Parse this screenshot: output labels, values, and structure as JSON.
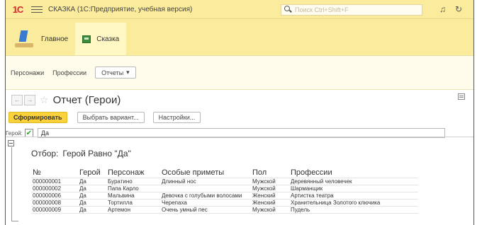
{
  "titlebar": {
    "logo": "1С",
    "title": "СКАЗКА  (1С:Предприятие, учебная версия)",
    "search_placeholder": "Поиск Ctrl+Shift+F"
  },
  "sections": [
    {
      "label": "Главное"
    },
    {
      "label": "Сказка"
    }
  ],
  "nav": {
    "links": [
      "Персонажи",
      "Профессии"
    ],
    "reports_label": "Отчеты"
  },
  "form": {
    "title": "Отчет (Герои)"
  },
  "commands": {
    "generate": "Сформировать",
    "choose_variant": "Выбрать вариант...",
    "settings": "Настройки..."
  },
  "filter": {
    "label": "Герой:",
    "checked": true,
    "value": "Да"
  },
  "report": {
    "filter_label": "Отбор:",
    "filter_text": "Герой Равно \"Да\"",
    "columns": [
      "№",
      "Герой",
      "Персонаж",
      "Особые приметы",
      "Пол",
      "Профессии"
    ],
    "rows": [
      [
        "000000001",
        "Да",
        "Буратино",
        "Длинный нос",
        "Мужской",
        "Деревянный человечек"
      ],
      [
        "000000002",
        "Да",
        "Папа Карло",
        "",
        "Мужской",
        "Шарманщик"
      ],
      [
        "000000006",
        "Да",
        "Мальвина",
        "Девочка с голубыми волосами",
        "Женский",
        "Артистка театра"
      ],
      [
        "000000008",
        "Да",
        "Тортилла",
        "Черепаха",
        "Женский",
        "Хранительница Золотого ключика"
      ],
      [
        "000000009",
        "Да",
        "Артемон",
        "Очень умный пес",
        "Мужской",
        "Пудель"
      ]
    ]
  }
}
